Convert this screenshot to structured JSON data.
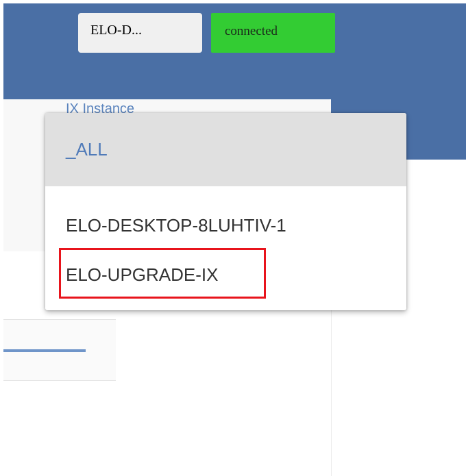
{
  "header": {
    "instance_chip": "ELO-D...",
    "status_text": "connected",
    "background_color": "#4a6fa5",
    "status_color": "#33cc33"
  },
  "filter": {
    "label": "IX Instance",
    "dropdown": {
      "selected": "_ALL",
      "options": [
        {
          "label": "_ALL",
          "selected": true
        },
        {
          "label": "ELO-DESKTOP-8LUHTIV-1",
          "selected": false
        },
        {
          "label": "ELO-UPGRADE-IX",
          "selected": false,
          "highlighted": true
        }
      ],
      "highlight_color": "#e8141c",
      "selected_text_color": "#4f7ab8"
    }
  }
}
